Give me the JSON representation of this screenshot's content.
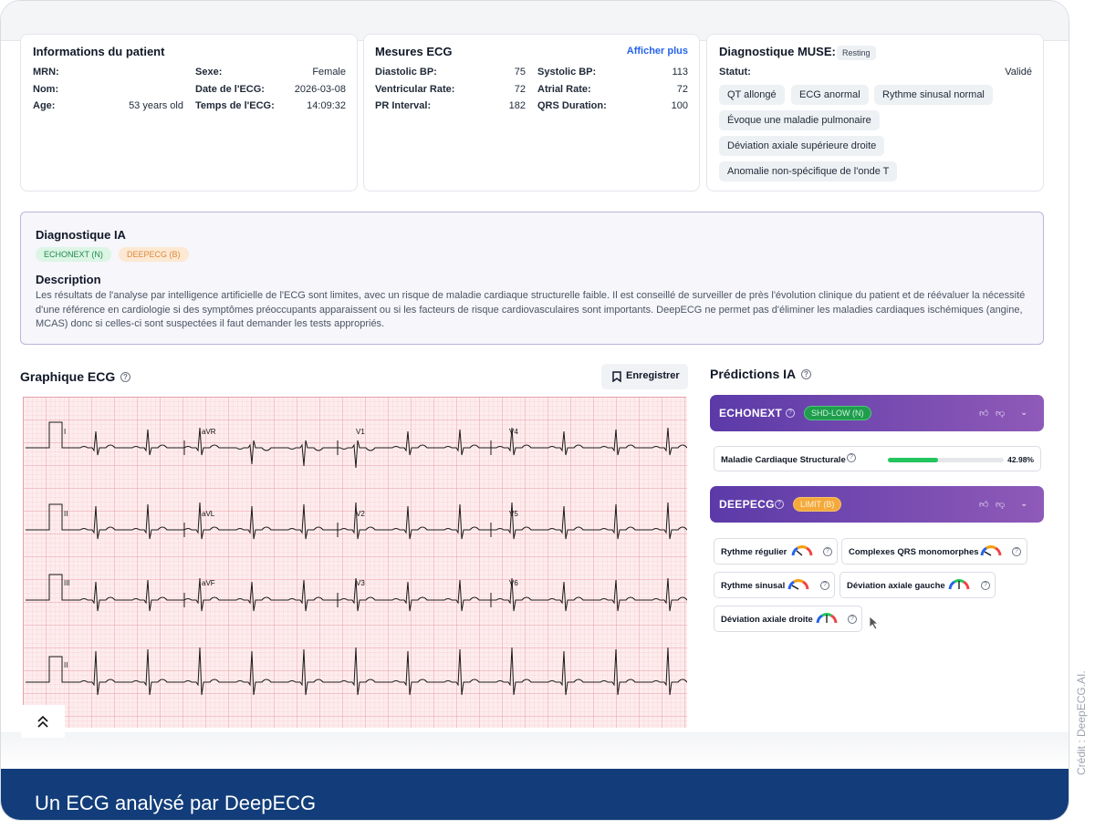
{
  "patient": {
    "title": "Informations du patient",
    "mrn_label": "MRN:",
    "mrn_value": "",
    "nom_label": "Nom:",
    "nom_value": "",
    "age_label": "Age:",
    "age_value": "53 years old",
    "sexe_label": "Sexe:",
    "sexe_value": "Female",
    "date_label": "Date de l'ECG:",
    "date_value": "2026-03-08",
    "time_label": "Temps de l'ECG:",
    "time_value": "14:09:32"
  },
  "measures": {
    "title": "Mesures ECG",
    "more_link": "Afficher plus",
    "diastolic_label": "Diastolic BP:",
    "diastolic_value": "75",
    "vent_label": "Ventricular Rate:",
    "vent_value": "72",
    "pr_label": "PR Interval:",
    "pr_value": "182",
    "systolic_label": "Systolic BP:",
    "systolic_value": "113",
    "atrial_label": "Atrial Rate:",
    "atrial_value": "72",
    "qrs_label": "QRS Duration:",
    "qrs_value": "100"
  },
  "muse": {
    "title": "Diagnostique MUSE:",
    "badge": "Resting",
    "status_label": "Statut:",
    "status_value": "Validé",
    "tags": [
      "QT allongé",
      "ECG anormal",
      "Rythme sinusal normal",
      "Évoque une maladie pulmonaire",
      "Déviation axiale supérieure droite",
      "Anomalie non-spécifique de l'onde T"
    ]
  },
  "ia": {
    "title": "Diagnostique IA",
    "pills": [
      "ECHONEXT (N)",
      "DEEPECG (B)"
    ],
    "description_title": "Description",
    "description": "Les résultats de l'analyse par intelligence artificielle de l'ECG sont limites, avec un risque de maladie cardiaque structurelle faible. Il est conseillé de surveiller de près l'évolution clinique du patient et de réévaluer la nécessité d'une référence en cardiologie si des symptômes préoccupants apparaissent ou si les facteurs de risque cardiovasculaires sont importants. DeepECG ne permet pas d'éliminer les maladies cardiaques ischémiques (angine, MCAS) donc si celles-ci sont suspectées il faut demander les tests appropriés."
  },
  "ecg": {
    "title": "Graphique ECG",
    "save_label": "Enregistrer",
    "leads": [
      "I",
      "aVR",
      "V1",
      "V4",
      "II",
      "aVL",
      "V2",
      "V5",
      "III",
      "aVF",
      "V3",
      "V6",
      "II"
    ]
  },
  "predictions": {
    "title": "Prédictions IA",
    "echonext": {
      "name": "ECHONEXT",
      "pill": "SHD-LOW (N)",
      "metric_label": "Maladie Cardiaque Structurale",
      "metric_value": "42.98%",
      "metric_fraction": 0.4298
    },
    "deepecg": {
      "name": "DEEPECG",
      "pill": "LIMIT (B)",
      "items": [
        "Rythme régulier",
        "Complexes QRS monomorphes",
        "Rythme sinusal",
        "Déviation axiale gauche",
        "Déviation axiale droite"
      ]
    }
  },
  "caption": "Un ECG analysé par DeepECG",
  "credit": "Crédit : DeepECG.AI.",
  "colors": {
    "caption_bg": "#123d7a",
    "model_bar_start": "#5b3aa8",
    "model_bar_end": "#8f5ab8",
    "ecg_grid": "#e6a1a8",
    "progress_green": "#22c55e",
    "pill_green_bg": "#dcf5e5",
    "pill_orange_bg": "#fde8d3"
  },
  "icons": [
    "help-icon",
    "bookmark-icon",
    "thumbs-up-icon",
    "thumbs-down-icon",
    "chevron-down-icon",
    "gauge-icon",
    "double-chevron-up-icon",
    "cursor-icon"
  ]
}
